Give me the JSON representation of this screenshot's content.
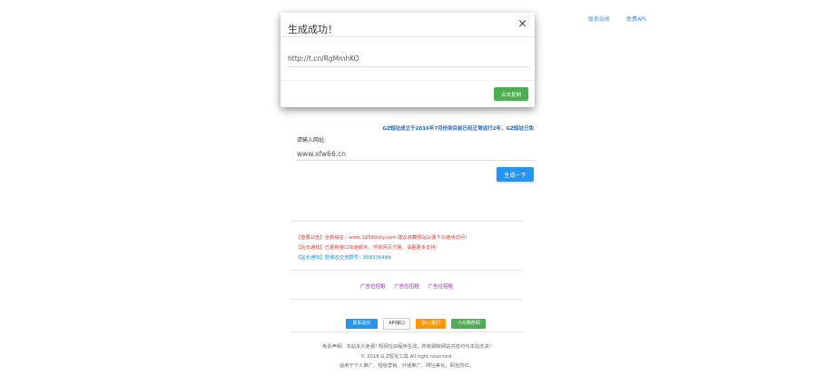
{
  "top_links": {
    "link1": "联系站长",
    "link2": "免费API"
  },
  "notice": "GZ短址成立于2016年7月份到目前已经正常运行2年，GZ短址已免",
  "form": {
    "label": "请输入网址:",
    "input_value": "www.xfw66.cn",
    "generate_button": "生成一下"
  },
  "announcements": [
    {
      "text": "【重要公告】全新域名：www.12580sky.com 建议收藏网站以便下次继续访问！",
      "color": "red"
    },
    {
      "text": "【站长通知】已更新接口加速服务，浮获网页方便，请量更多支持！",
      "color": "red"
    },
    {
      "text": "【站长通知】短域名交流群号：808335489",
      "color": "blue"
    }
  ],
  "ads": [
    "广告位招租",
    "广告位招租",
    "广告位招租"
  ],
  "buttons": {
    "b1": "联系站长",
    "b2": "API接口",
    "b3": "加入我们",
    "b4": "小众推荐网"
  },
  "footer": {
    "line1": "免责声明：本站永久免费! 短网址由程序生成，所有跳转网站内容均与本站无关!",
    "line2": "© 2018 G.Z短址工具 All right reserved.",
    "line3": "适用于个人推广、短信营销、外链推广、网址美化、网址防红。"
  },
  "modal": {
    "title": "生成成功！",
    "close_glyph": "×",
    "short_link": "http://t.cn/RgMmhKO",
    "copy_button": "点击复制"
  },
  "colors": {
    "primary_blue": "#2196f3",
    "success_green": "#4caf50",
    "warning_orange": "#ff9800",
    "notice_red": "#e53935",
    "ad_purple": "#9c27b0"
  }
}
